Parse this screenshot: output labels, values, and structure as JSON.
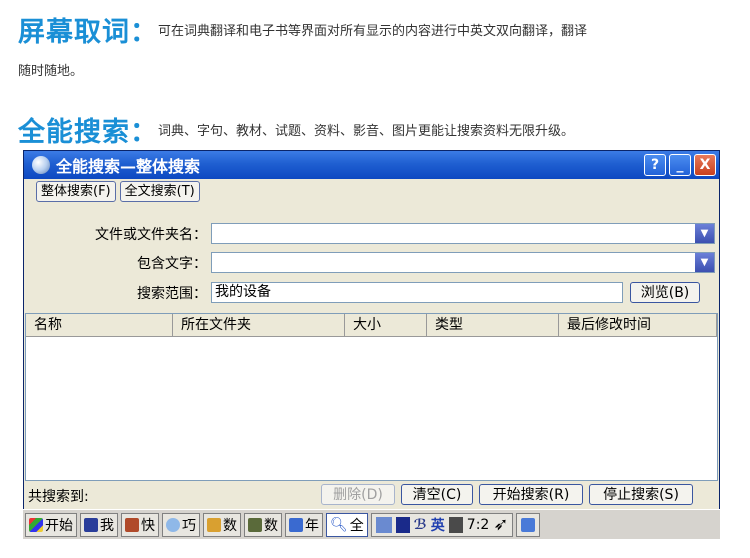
{
  "promo": {
    "line1_head": "屏幕取词：",
    "line1_desc": "可在词典翻译和电子书等界面对所有显示的内容进行中英文双向翻译，翻译",
    "line1_cont": "随时随地。",
    "line2_head": "全能搜索：",
    "line2_desc": "词典、字句、教材、试题、资料、影音、图片更能让搜索资料无限升级。"
  },
  "window": {
    "title": "全能搜索—整体搜索",
    "help": "?",
    "minimize": "_",
    "close": "X",
    "tabs": [
      "整体搜索(F)",
      "全文搜索(T)"
    ],
    "form": {
      "filename_label": "文件或文件夹名：",
      "filename_value": "",
      "contains_label": "包含文字：",
      "contains_value": "",
      "scope_label": "搜索范围：",
      "scope_value": "我的设备",
      "browse": "浏览(B)"
    },
    "columns": [
      "名称",
      "所在文件夹",
      "大小",
      "类型",
      "最后修改时间"
    ],
    "found_label": "共搜索到:",
    "buttons": {
      "delete": "删除(D)",
      "clear": "清空(C)",
      "start": "开始搜索(R)",
      "stop": "停止搜索(S)"
    }
  },
  "taskbar": {
    "start": "开始",
    "items": [
      "我",
      "快",
      "巧",
      "数",
      "数",
      "年",
      "全"
    ],
    "tray_en": "英",
    "clock": "7:2"
  },
  "colors": {
    "accent": "#1a8fd6",
    "titlebar": "#1f5fd1"
  }
}
